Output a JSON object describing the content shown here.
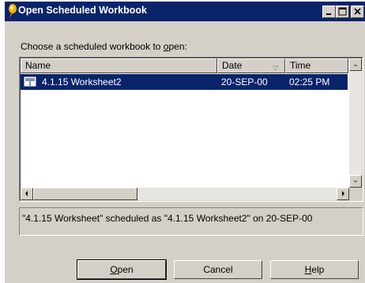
{
  "window": {
    "title": "Open Scheduled Workbook",
    "controls": {
      "minimize": "minimize",
      "maximize": "maximize",
      "close": "close"
    }
  },
  "prompt": {
    "before": "Choose a scheduled workbook to ",
    "accel": "o",
    "after": "pen:"
  },
  "list": {
    "columns": [
      "Name",
      "Date",
      "Time"
    ],
    "sort_indicator": "▽",
    "rows": [
      {
        "name": "4.1.15 Worksheet2",
        "date": "20-SEP-00",
        "time": "02:25 PM",
        "selected": true,
        "icon": "workbook-icon"
      }
    ]
  },
  "status_text": "\"4.1.15 Worksheet\" scheduled as \"4.1.15 Worksheet2\" on 20-SEP-00",
  "buttons": {
    "open": {
      "before": "",
      "accel": "O",
      "after": "pen"
    },
    "cancel": {
      "label": "Cancel"
    },
    "help": {
      "before": "",
      "accel": "H",
      "after": "elp"
    }
  },
  "colors": {
    "titlebar": "#0a246a",
    "selection": "#0a246a",
    "face": "#d4d0c8"
  }
}
